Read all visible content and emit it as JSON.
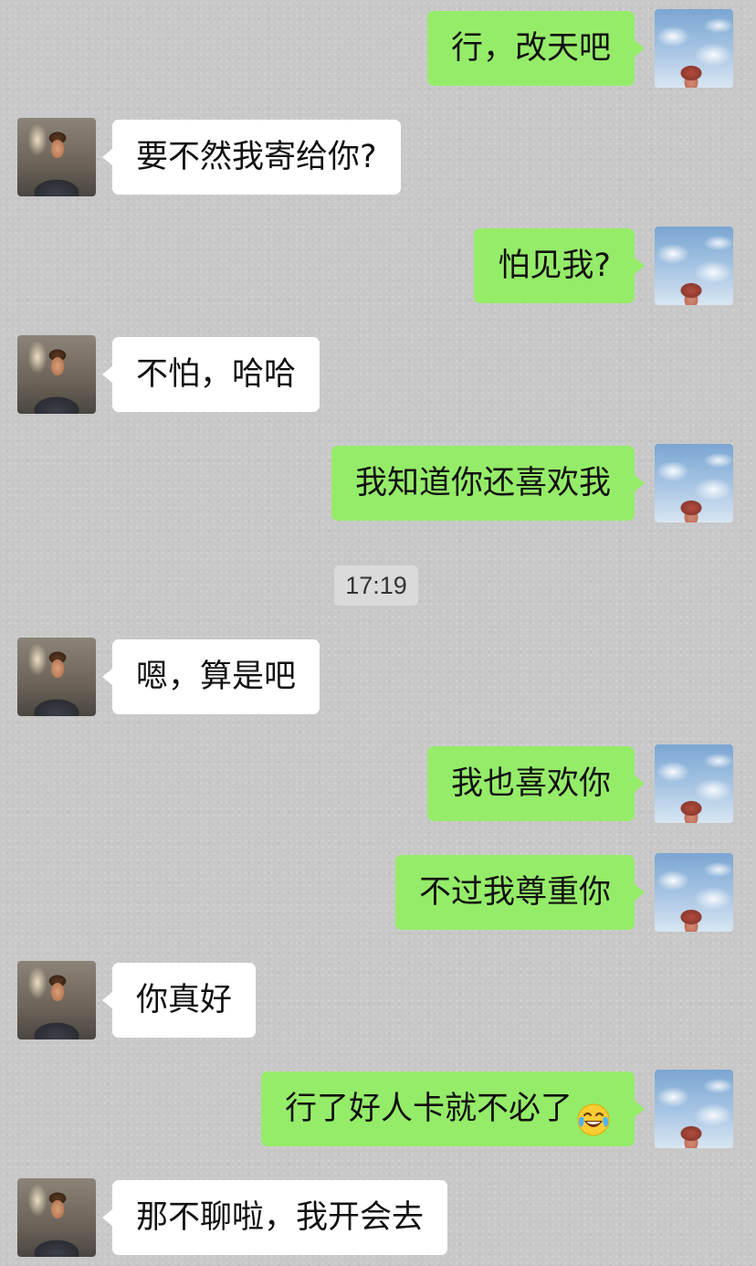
{
  "messages": [
    {
      "side": "me",
      "text": "行，改天吧"
    },
    {
      "side": "them",
      "text": "要不然我寄给你?"
    },
    {
      "side": "me",
      "text": "怕见我?"
    },
    {
      "side": "them",
      "text": "不怕，哈哈"
    },
    {
      "side": "me",
      "text": "我知道你还喜欢我"
    },
    {
      "side": "them",
      "text": "嗯，算是吧"
    },
    {
      "side": "me",
      "text": "我也喜欢你"
    },
    {
      "side": "me",
      "text": "不过我尊重你"
    },
    {
      "side": "them",
      "text": "你真好"
    },
    {
      "side": "me",
      "text": "行了好人卡就不必了",
      "emoji": "tears-of-joy-emoji"
    },
    {
      "side": "them",
      "text": "那不聊啦，我开会去"
    }
  ],
  "timestamp": "17:19",
  "colors": {
    "my_bubble": "#95ec69",
    "their_bubble": "#ffffff",
    "background": "#c8c8c8",
    "timestamp_bg": "#dadada"
  }
}
